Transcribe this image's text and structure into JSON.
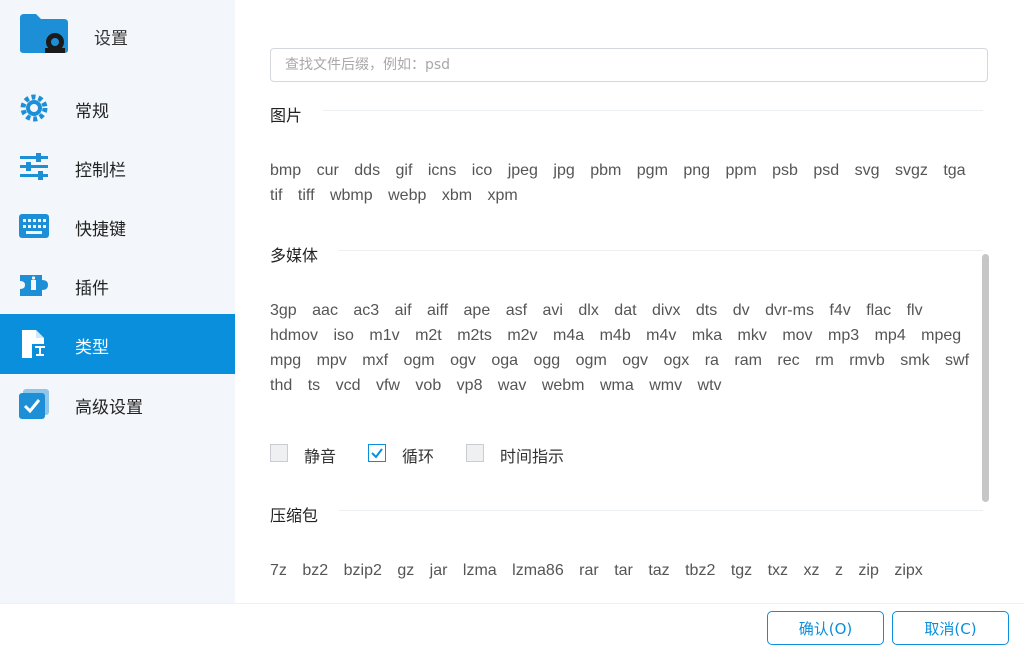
{
  "app": {
    "title": "设置"
  },
  "sidebar": {
    "items": [
      {
        "label": "常规",
        "icon": "gear-icon",
        "active": false
      },
      {
        "label": "控制栏",
        "icon": "sliders-icon",
        "active": false
      },
      {
        "label": "快捷键",
        "icon": "keyboard-icon",
        "active": false
      },
      {
        "label": "插件",
        "icon": "plugin-icon",
        "active": false
      },
      {
        "label": "类型",
        "icon": "file-type-icon",
        "active": true
      },
      {
        "label": "高级设置",
        "icon": "checkbox-icon",
        "active": false
      }
    ]
  },
  "search": {
    "placeholder": "查找文件后缀，例如：psd",
    "value": ""
  },
  "sections": {
    "images": {
      "title": "图片",
      "extensions": [
        "bmp",
        "cur",
        "dds",
        "gif",
        "icns",
        "ico",
        "jpeg",
        "jpg",
        "pbm",
        "pgm",
        "png",
        "ppm",
        "psb",
        "psd",
        "svg",
        "svgz",
        "tga",
        "tif",
        "tiff",
        "wbmp",
        "webp",
        "xbm",
        "xpm"
      ]
    },
    "media": {
      "title": "多媒体",
      "extensions": [
        "3gp",
        "aac",
        "ac3",
        "aif",
        "aiff",
        "ape",
        "asf",
        "avi",
        "dlx",
        "dat",
        "divx",
        "dts",
        "dv",
        "dvr-ms",
        "f4v",
        "flac",
        "flv",
        "hdmov",
        "iso",
        "m1v",
        "m2t",
        "m2ts",
        "m2v",
        "m4a",
        "m4b",
        "m4v",
        "mka",
        "mkv",
        "mov",
        "mp3",
        "mp4",
        "mpeg",
        "mpg",
        "mpv",
        "mxf",
        "ogm",
        "ogv",
        "oga",
        "ogg",
        "ogm",
        "ogv",
        "ogx",
        "ra",
        "ram",
        "rec",
        "rm",
        "rmvb",
        "smk",
        "swf",
        "thd",
        "ts",
        "vcd",
        "vfw",
        "vob",
        "vp8",
        "wav",
        "webm",
        "wma",
        "wmv",
        "wtv"
      ],
      "options": [
        {
          "label": "静音",
          "checked": false
        },
        {
          "label": "循环",
          "checked": true
        },
        {
          "label": "时间指示",
          "checked": false
        }
      ]
    },
    "archives": {
      "title": "压缩包",
      "extensions": [
        "7z",
        "bz2",
        "bzip2",
        "gz",
        "jar",
        "lzma",
        "lzma86",
        "rar",
        "tar",
        "taz",
        "tbz2",
        "tgz",
        "txz",
        "xz",
        "z",
        "zip",
        "zipx"
      ]
    }
  },
  "footer": {
    "confirm_label": "确认(O)",
    "cancel_label": "取消(C)"
  },
  "colors": {
    "accent": "#0a8fdc",
    "sidebar_bg": "#f3f7fb"
  }
}
